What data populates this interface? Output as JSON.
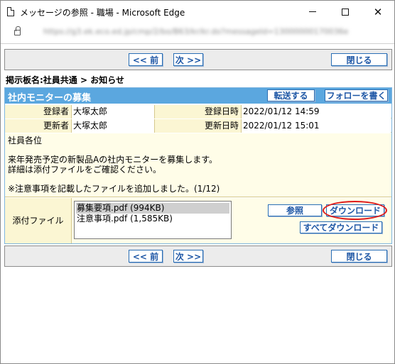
{
  "window": {
    "title": "メッセージの参照 - 職場 - Microsoft Edge",
    "url": "https://g3.ek.eco.ed.jp/cmp/2/bo/B63/kr/kr.do?messageId=13000000170036e"
  },
  "nav": {
    "prev_label": "<< 前",
    "next_label": "次 >>",
    "close_label": "閉じる"
  },
  "breadcrumb": "掲示板名:社員共通 > お知らせ",
  "message": {
    "title": "社内モニターの募集",
    "forward_label": "転送する",
    "reply_label": "フォローを書く",
    "registrant_label": "登録者",
    "registrant": "大塚太郎",
    "registered_at_label": "登録日時",
    "registered_at": "2022/01/12 14:59",
    "updater_label": "更新者",
    "updater": "大塚太郎",
    "updated_at_label": "更新日時",
    "updated_at": "2022/01/12 15:01",
    "body": {
      "line1": "社員各位",
      "line2": "来年発売予定の新製品Aの社内モニターを募集します。",
      "line3": "詳細は添付ファイルをご確認ください。",
      "line4": "※注意事項を記載したファイルを追加しました。(1/12)"
    }
  },
  "attachments": {
    "label": "添付ファイル",
    "files": [
      "募集要項.pdf (994KB)",
      "注意事項.pdf (1,585KB)"
    ],
    "selected_index": 0,
    "browse_label": "参照",
    "download_label": "ダウンロード",
    "download_all_label": "すべてダウンロード"
  },
  "colors": {
    "header_blue": "#5ba7df",
    "button_text": "#1d56a5",
    "highlight": "#e01a1a",
    "label_bg": "#fbf6d3"
  }
}
